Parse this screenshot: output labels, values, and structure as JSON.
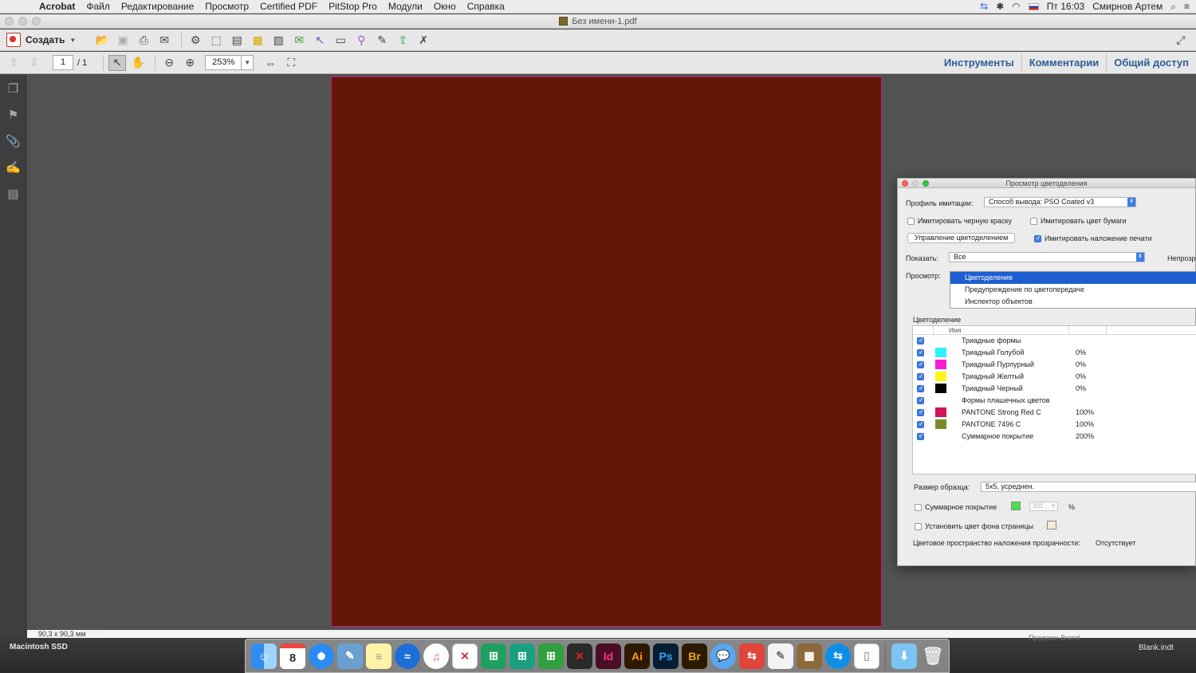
{
  "menubar": {
    "app_name": "Acrobat",
    "menus": [
      "Файл",
      "Редактирование",
      "Просмотр",
      "Certified PDF",
      "PitStop Pro",
      "Модули",
      "Окно",
      "Справка"
    ],
    "clock": "Пт 16:03",
    "user": "Смирнов Артем"
  },
  "window": {
    "title": "Без имени-1.pdf"
  },
  "toolbar": {
    "create_label": "Создать",
    "page_current": "1",
    "page_total": "/ 1",
    "zoom": "253%",
    "tools_label": "Инструменты",
    "comments_label": "Комментарии",
    "share_label": "Общий доступ"
  },
  "document": {
    "page_color": "#631807",
    "size_readout": "90,3 x 90,3 мм"
  },
  "output_preview": {
    "title": "Просмотр цветоделения",
    "profile_label": "Профиль имитации:",
    "profile_value": "Способ вывода: PSO Coated v3",
    "simulate_black_label": "Имитировать черную краску",
    "simulate_paper_label": "Имитировать цвет бумаги",
    "ink_manager_button": "Управление цветоделением",
    "simulate_overprint_label": "Имитировать наложение печати",
    "show_label": "Показать:",
    "show_value": "Все",
    "opacity_label": "Непрозр",
    "preview_label": "Просмотр:",
    "preview_options": [
      {
        "label": "Цветоделение",
        "selected": true
      },
      {
        "label": "Предупреждение по цветопередаче",
        "selected": false
      },
      {
        "label": "Инспектор объектов",
        "selected": false
      }
    ],
    "separations_heading": "Цветоделение",
    "name_column": "Имя",
    "separations": [
      {
        "name": "Триадные формы",
        "value": "",
        "color": ""
      },
      {
        "name": "Триадный Голубой",
        "value": "0%",
        "color": "#2ef0ff"
      },
      {
        "name": "Триадный Пурпурный",
        "value": "0%",
        "color": "#ff1ad9"
      },
      {
        "name": "Триадный Желтый",
        "value": "0%",
        "color": "#fff51a"
      },
      {
        "name": "Триадный Черный",
        "value": "0%",
        "color": "#050505"
      },
      {
        "name": "Формы плашечных цветов",
        "value": "",
        "color": ""
      },
      {
        "name": "PANTONE Strong Red C",
        "value": "100%",
        "color": "#d4145a"
      },
      {
        "name": "PANTONE 7496 C",
        "value": "100%",
        "color": "#7b8a2a"
      },
      {
        "name": "Суммарное покрытие",
        "value": "200%",
        "color": ""
      }
    ],
    "sample_size_label": "Размер образца:",
    "sample_size_value": "5x5, усреднен.",
    "total_coverage_label": "Суммарное покрытие",
    "total_coverage_value": "301",
    "percent_sign": "%",
    "page_bg_label": "Установить цвет фона страницы",
    "transparency_label": "Цветовое пространство наложения прозрачности:",
    "transparency_value": "Отсутствует"
  },
  "desktop": {
    "drive_label": "Macintosh SSD",
    "file_label": "Blank.indt",
    "file_label_2": "Продажи.Brand"
  },
  "dock": {
    "calendar_day": "8",
    "indesign": "Id",
    "illustrator": "Ai",
    "photoshop": "Ps",
    "bridge": "Br"
  }
}
